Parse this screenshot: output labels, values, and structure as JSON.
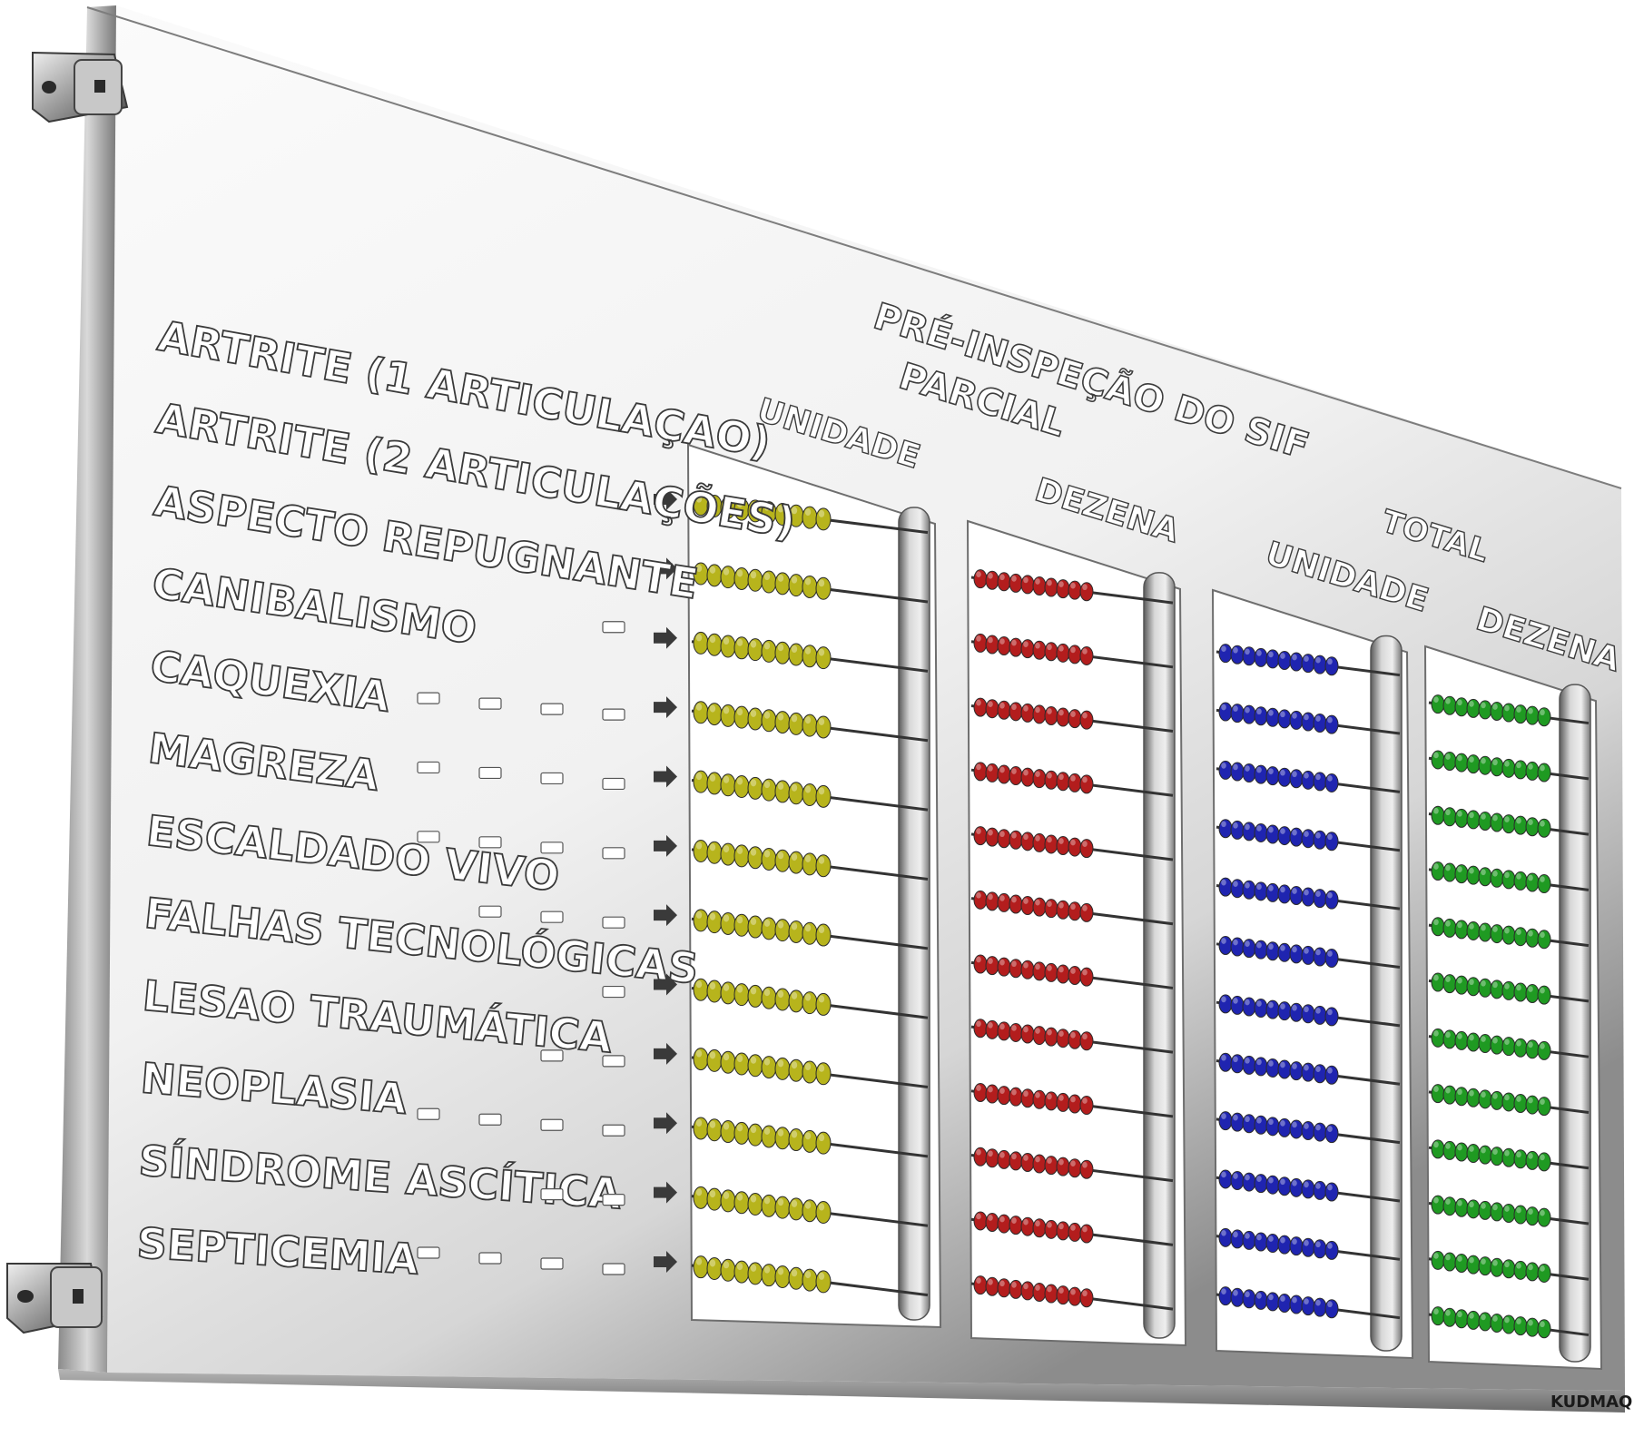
{
  "panel": {
    "header": "PRÉ-INSPEÇÃO DO SIF",
    "groups": [
      {
        "label": "PARCIAL"
      },
      {
        "label": "TOTAL"
      }
    ],
    "columns": [
      {
        "label": "UNIDADE",
        "bead_color": "#b7b41c"
      },
      {
        "label": "DEZENA",
        "bead_color": "#b31d1d"
      },
      {
        "label": "UNIDADE",
        "bead_color": "#1f24b0"
      },
      {
        "label": "DEZENA",
        "bead_color": "#1f9a22"
      }
    ],
    "rows": [
      {
        "label": "ARTRITE (1 ARTICULAÇAO)"
      },
      {
        "label": "ARTRITE (2 ARTICULAÇÕES)"
      },
      {
        "label": "ASPECTO REPUGNANTE"
      },
      {
        "label": "CANIBALISMO"
      },
      {
        "label": "CAQUEXIA"
      },
      {
        "label": "MAGREZA"
      },
      {
        "label": "ESCALDADO VIVO"
      },
      {
        "label": "FALHAS TECNOLÓGICAS"
      },
      {
        "label": "LESAO TRAUMÁTICA"
      },
      {
        "label": "NEOPLASIA"
      },
      {
        "label": "SÍNDROME ASCÍTICA"
      },
      {
        "label": "SEPTICEMIA"
      }
    ],
    "beads_per_rod": 10,
    "brand": "KUDMAQ",
    "panel_color": "#f4f4f4",
    "edge_color": "#9a9a9a"
  }
}
